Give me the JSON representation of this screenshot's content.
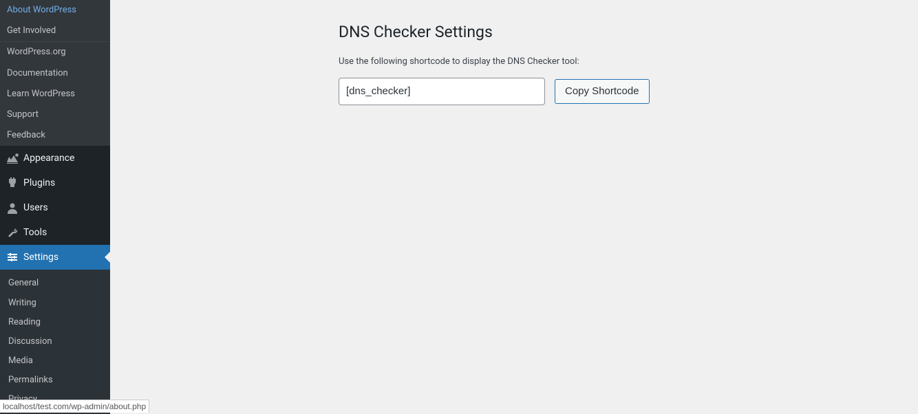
{
  "sidebar": {
    "top_links": [
      {
        "label": "About WordPress",
        "name": "about-wordpress"
      },
      {
        "label": "Get Involved",
        "name": "get-involved"
      }
    ],
    "resource_links": [
      {
        "label": "WordPress.org",
        "name": "wordpress-org"
      },
      {
        "label": "Documentation",
        "name": "documentation"
      },
      {
        "label": "Learn WordPress",
        "name": "learn-wordpress"
      },
      {
        "label": "Support",
        "name": "support"
      },
      {
        "label": "Feedback",
        "name": "feedback"
      }
    ],
    "menu": [
      {
        "label": "Appearance",
        "name": "appearance",
        "icon": "appearance-icon"
      },
      {
        "label": "Plugins",
        "name": "plugins",
        "icon": "plugins-icon"
      },
      {
        "label": "Users",
        "name": "users",
        "icon": "users-icon"
      },
      {
        "label": "Tools",
        "name": "tools",
        "icon": "tools-icon"
      },
      {
        "label": "Settings",
        "name": "settings",
        "icon": "settings-icon",
        "active": true
      }
    ],
    "submenu": [
      {
        "label": "General",
        "name": "settings-general"
      },
      {
        "label": "Writing",
        "name": "settings-writing"
      },
      {
        "label": "Reading",
        "name": "settings-reading"
      },
      {
        "label": "Discussion",
        "name": "settings-discussion"
      },
      {
        "label": "Media",
        "name": "settings-media"
      },
      {
        "label": "Permalinks",
        "name": "settings-permalinks"
      },
      {
        "label": "Privacy",
        "name": "settings-privacy"
      }
    ]
  },
  "page": {
    "title": "DNS Checker Settings",
    "intro": "Use the following shortcode to display the DNS Checker tool:",
    "shortcode_value": "[dns_checker]",
    "copy_button_label": "Copy Shortcode"
  },
  "status_url": "localhost/test.com/wp-admin/about.php"
}
